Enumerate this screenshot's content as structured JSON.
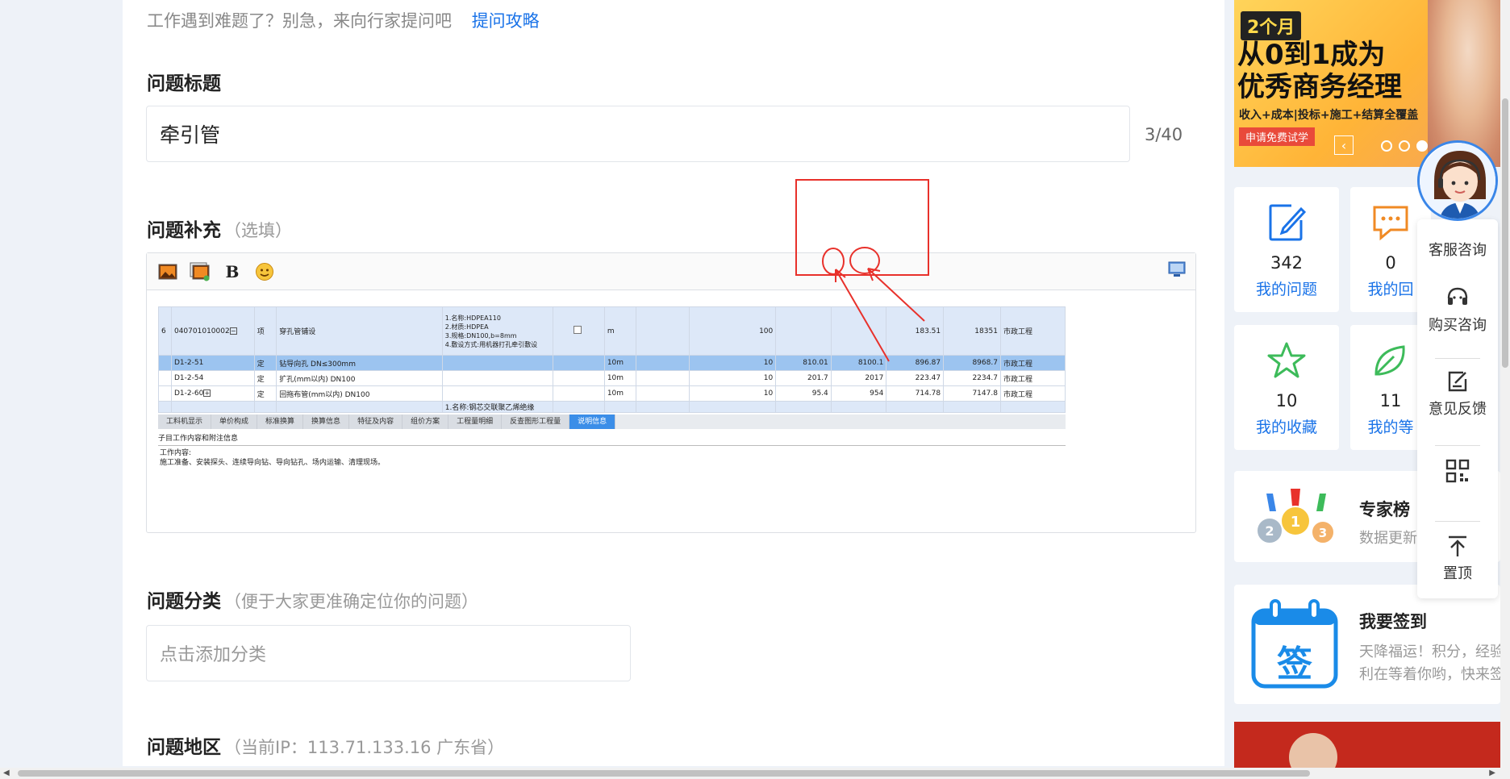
{
  "main": {
    "tip_text": "工作遇到难题了？别急，来向行家提问吧",
    "tip_link": "提问攻略",
    "question_title_label": "问题标题",
    "question_title_value": "牵引管",
    "title_counter": "3/40",
    "supplement_label": "问题补充",
    "supplement_hint": "（选填）",
    "category_label": "问题分类",
    "category_hint": "（便于大家更准确定位你的问题）",
    "category_placeholder": "点击添加分类",
    "region_label": "问题地区",
    "region_hint": "（当前IP：113.71.133.16 广东省）"
  },
  "editor_toolbar": {
    "bold_label": "B",
    "icons": [
      "image-icon",
      "image-gallery-icon",
      "bold-icon",
      "emoji-icon",
      "preview-icon"
    ]
  },
  "embedded_screenshot": {
    "rows": [
      {
        "idx": "6",
        "code": "040701010002",
        "type": "项",
        "name": "穿孔管铺设",
        "spec": "1.名称:HDPEA110\n2.材质:HDPEA\n3.规格:DN100,b=8mm\n4.敷设方式:用机器打孔牵引敷设",
        "unit": "m",
        "qty": "100",
        "price": "",
        "total": "",
        "c1": "183.51",
        "c2": "18351",
        "area": "市政工程"
      },
      {
        "idx": "",
        "code": "D1-2-51",
        "type": "定",
        "name": "钻导向孔 DN≤300mm",
        "spec": "",
        "unit": "10m",
        "qty": "10",
        "price": "810.01",
        "total": "8100.1",
        "c1": "896.87",
        "c2": "8968.7",
        "area": "市政工程"
      },
      {
        "idx": "",
        "code": "D1-2-54",
        "type": "定",
        "name": "扩孔(mm以内) DN100",
        "spec": "",
        "unit": "10m",
        "qty": "10",
        "price": "201.7",
        "total": "2017",
        "c1": "223.47",
        "c2": "2234.7",
        "area": "市政工程"
      },
      {
        "idx": "",
        "code": "D1-2-60",
        "type": "定",
        "name": "回拖布管(mm以内) DN100",
        "spec": "",
        "unit": "10m",
        "qty": "10",
        "price": "95.4",
        "total": "954",
        "c1": "714.78",
        "c2": "7147.8",
        "area": "市政工程"
      }
    ],
    "cut_row_spec": "1.名称:钢芯交联聚乙烯绝缘",
    "tabs": [
      "工料机显示",
      "单价构成",
      "标准换算",
      "换算信息",
      "特征及内容",
      "组价方案",
      "工程量明细",
      "反查图形工程量",
      "说明信息"
    ],
    "active_tab": "说明信息",
    "desc_title": "子目工作内容和附注信息",
    "work_label": "工作内容:",
    "work_content": "施工准备、安装探头、连续导向钻、导向钻孔、场内运输、清理现场。"
  },
  "sidebar": {
    "banner": {
      "tag": "2个月",
      "headline_1": "从0到1成为",
      "headline_2": "优秀商务经理",
      "subline": "收入+成本|投标+施工+结算全覆盖",
      "button": "申请免费试学",
      "nav_prev": "‹"
    },
    "stats": [
      {
        "value": "342",
        "label": "我的问题",
        "icon": "edit-note-icon"
      },
      {
        "value": "0",
        "label": "我的回",
        "icon": "chat-bubble-icon"
      },
      {
        "value": "10",
        "label": "我的收藏",
        "icon": "star-icon"
      },
      {
        "value": "11",
        "label": "我的等",
        "icon": "leaf-icon"
      }
    ],
    "experts": {
      "title": "专家榜",
      "subtitle": "数据更新"
    },
    "signin": {
      "title": "我要签到",
      "line1": "天降福运！积分，经验",
      "line2": "利在等着你哟，快来签",
      "badge": "签"
    }
  },
  "float_bar": {
    "service": "客服咨询",
    "buy": "购买咨询",
    "feedback": "意见反馈",
    "top": "置顶"
  },
  "colors": {
    "accent": "#1a73e8",
    "annotation_red": "#e8312b",
    "sidebar_bg": "#eef2f8"
  }
}
